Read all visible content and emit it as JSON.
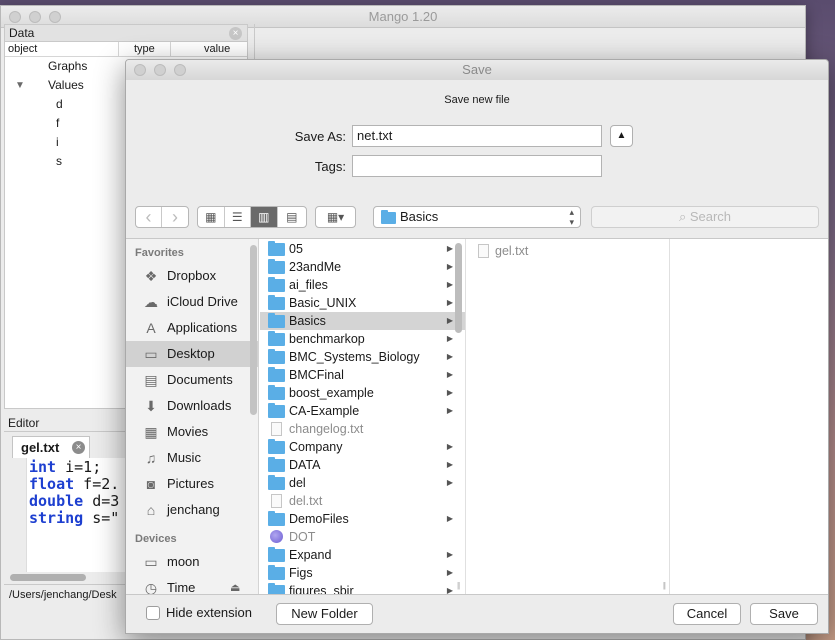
{
  "main_window": {
    "title": "Mango 1.20",
    "data_panel": {
      "title": "Data",
      "close_glyph": "×",
      "columns": [
        "object",
        "type",
        "value"
      ],
      "tree": [
        {
          "label": "Graphs",
          "depth": 1
        },
        {
          "label": "Values",
          "depth": 1,
          "expanded": true
        },
        {
          "label": "d",
          "depth": 2
        },
        {
          "label": "f",
          "depth": 2
        },
        {
          "label": "i",
          "depth": 2
        },
        {
          "label": "s",
          "depth": 2
        }
      ]
    },
    "editor": {
      "title": "Editor",
      "tab_label": "gel.txt",
      "close_glyph": "×",
      "code_lines": [
        {
          "keyword": "int",
          "rest": " i=1;"
        },
        {
          "keyword": "float",
          "rest": " f=2."
        },
        {
          "keyword": "double",
          "rest": " d=3"
        },
        {
          "keyword": "string",
          "rest": " s=\""
        }
      ],
      "status_path": "/Users/jenchang/Desk"
    }
  },
  "save_dialog": {
    "title": "Save",
    "caption": "Save new file",
    "save_as_label": "Save As:",
    "save_as_value": "net.txt",
    "tags_label": "Tags:",
    "tags_value": "",
    "expand_glyph": "▲",
    "nav": {
      "back": "‹",
      "forward": "›"
    },
    "view_modes": [
      {
        "name": "icon-view-icon",
        "glyph": "▦"
      },
      {
        "name": "list-view-icon",
        "glyph": "☰"
      },
      {
        "name": "column-view-icon",
        "glyph": "▥"
      },
      {
        "name": "coverflow-view-icon",
        "glyph": "▤"
      }
    ],
    "arrange_glyph": "▦▾",
    "location": "Basics",
    "search_placeholder": "Search",
    "sidebar": {
      "favorites_header": "Favorites",
      "favorites": [
        {
          "label": "Dropbox",
          "icon": "dropbox-icon",
          "glyph": "❖"
        },
        {
          "label": "iCloud Drive",
          "icon": "cloud-icon",
          "glyph": "☁"
        },
        {
          "label": "Applications",
          "icon": "applications-icon",
          "glyph": "A"
        },
        {
          "label": "Desktop",
          "icon": "desktop-icon",
          "glyph": "▭",
          "selected": true
        },
        {
          "label": "Documents",
          "icon": "documents-icon",
          "glyph": "▤"
        },
        {
          "label": "Downloads",
          "icon": "downloads-icon",
          "glyph": "⬇"
        },
        {
          "label": "Movies",
          "icon": "movies-icon",
          "glyph": "▦"
        },
        {
          "label": "Music",
          "icon": "music-icon",
          "glyph": "♫"
        },
        {
          "label": "Pictures",
          "icon": "pictures-icon",
          "glyph": "◙"
        },
        {
          "label": "jenchang",
          "icon": "home-icon",
          "glyph": "⌂"
        }
      ],
      "devices_header": "Devices",
      "devices": [
        {
          "label": "moon",
          "icon": "disk-icon",
          "glyph": "▭"
        },
        {
          "label": "Time",
          "icon": "time-machine-icon",
          "glyph": "◷",
          "eject": "⏏"
        }
      ]
    },
    "column1": [
      {
        "name": "05",
        "kind": "folder"
      },
      {
        "name": "23andMe",
        "kind": "folder"
      },
      {
        "name": "ai_files",
        "kind": "folder"
      },
      {
        "name": "Basic_UNIX",
        "kind": "folder"
      },
      {
        "name": "Basics",
        "kind": "folder",
        "selected": true
      },
      {
        "name": "benchmarkop",
        "kind": "folder"
      },
      {
        "name": "BMC_Systems_Biology",
        "kind": "folder"
      },
      {
        "name": "BMCFinal",
        "kind": "folder"
      },
      {
        "name": "boost_example",
        "kind": "folder"
      },
      {
        "name": "CA-Example",
        "kind": "folder"
      },
      {
        "name": "changelog.txt",
        "kind": "file"
      },
      {
        "name": "Company",
        "kind": "folder"
      },
      {
        "name": "DATA",
        "kind": "folder"
      },
      {
        "name": "del",
        "kind": "folder"
      },
      {
        "name": "del.txt",
        "kind": "file"
      },
      {
        "name": "DemoFiles",
        "kind": "folder"
      },
      {
        "name": "DOT",
        "kind": "app"
      },
      {
        "name": "Expand",
        "kind": "folder"
      },
      {
        "name": "Figs",
        "kind": "folder"
      },
      {
        "name": "figures_sbir",
        "kind": "folder"
      }
    ],
    "column2": [
      {
        "name": "gel.txt",
        "kind": "file"
      }
    ],
    "hide_extension_label": "Hide extension",
    "new_folder_label": "New Folder",
    "cancel_label": "Cancel",
    "save_label": "Save"
  }
}
